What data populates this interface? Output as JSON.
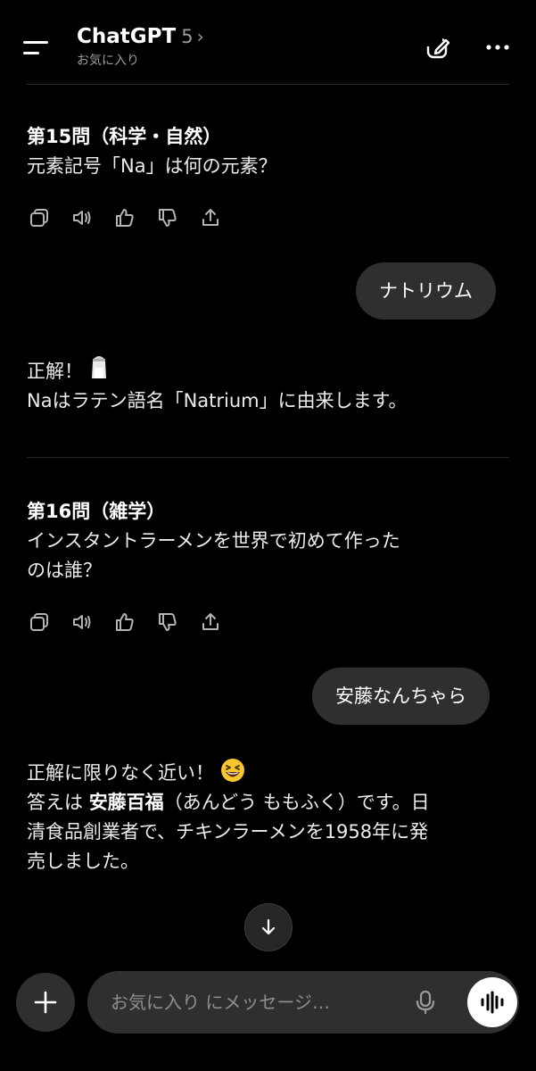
{
  "header": {
    "app_title": "ChatGPT",
    "model_version": "5",
    "model_chevron": "›",
    "subtitle": "お気に入り"
  },
  "messages": [
    {
      "role": "assistant",
      "heading": "第15問（科学・自然）",
      "lines": [
        "元素記号「Na」は何の元素？"
      ]
    },
    {
      "role": "user",
      "text": "ナトリウム"
    },
    {
      "role": "assistant",
      "line1": "正解！",
      "line1_emoji": "salt-shaker-emoji",
      "line2": "Naはラテン語名「Natrium」に由来します。"
    },
    {
      "role": "assistant",
      "heading": "第16問（雑学）",
      "lines": [
        "インスタントラーメンを世界で初めて作った",
        "のは誰？"
      ]
    },
    {
      "role": "user",
      "text": "安藤なんちゃら"
    },
    {
      "role": "assistant",
      "line1": "正解に限りなく近い！",
      "line1_emoji": "grinning-squinting-emoji",
      "line2_pre": "答えは ",
      "line2_bold": "安藤百福",
      "line2_post": "（あんどう ももふく）です。日",
      "line3": "清食品創業者で、チキンラーメンを1958年に発",
      "line4": "売しました。"
    }
  ],
  "action_icons": [
    "copy-icon",
    "speaker-icon",
    "thumbs-up-icon",
    "thumbs-down-icon",
    "share-icon"
  ],
  "composer": {
    "placeholder": "お気に入り にメッセージ…"
  },
  "colors": {
    "background": "#000000",
    "bubble": "#2f2f2f",
    "text": "#ececec",
    "muted": "#9b9b9b"
  }
}
